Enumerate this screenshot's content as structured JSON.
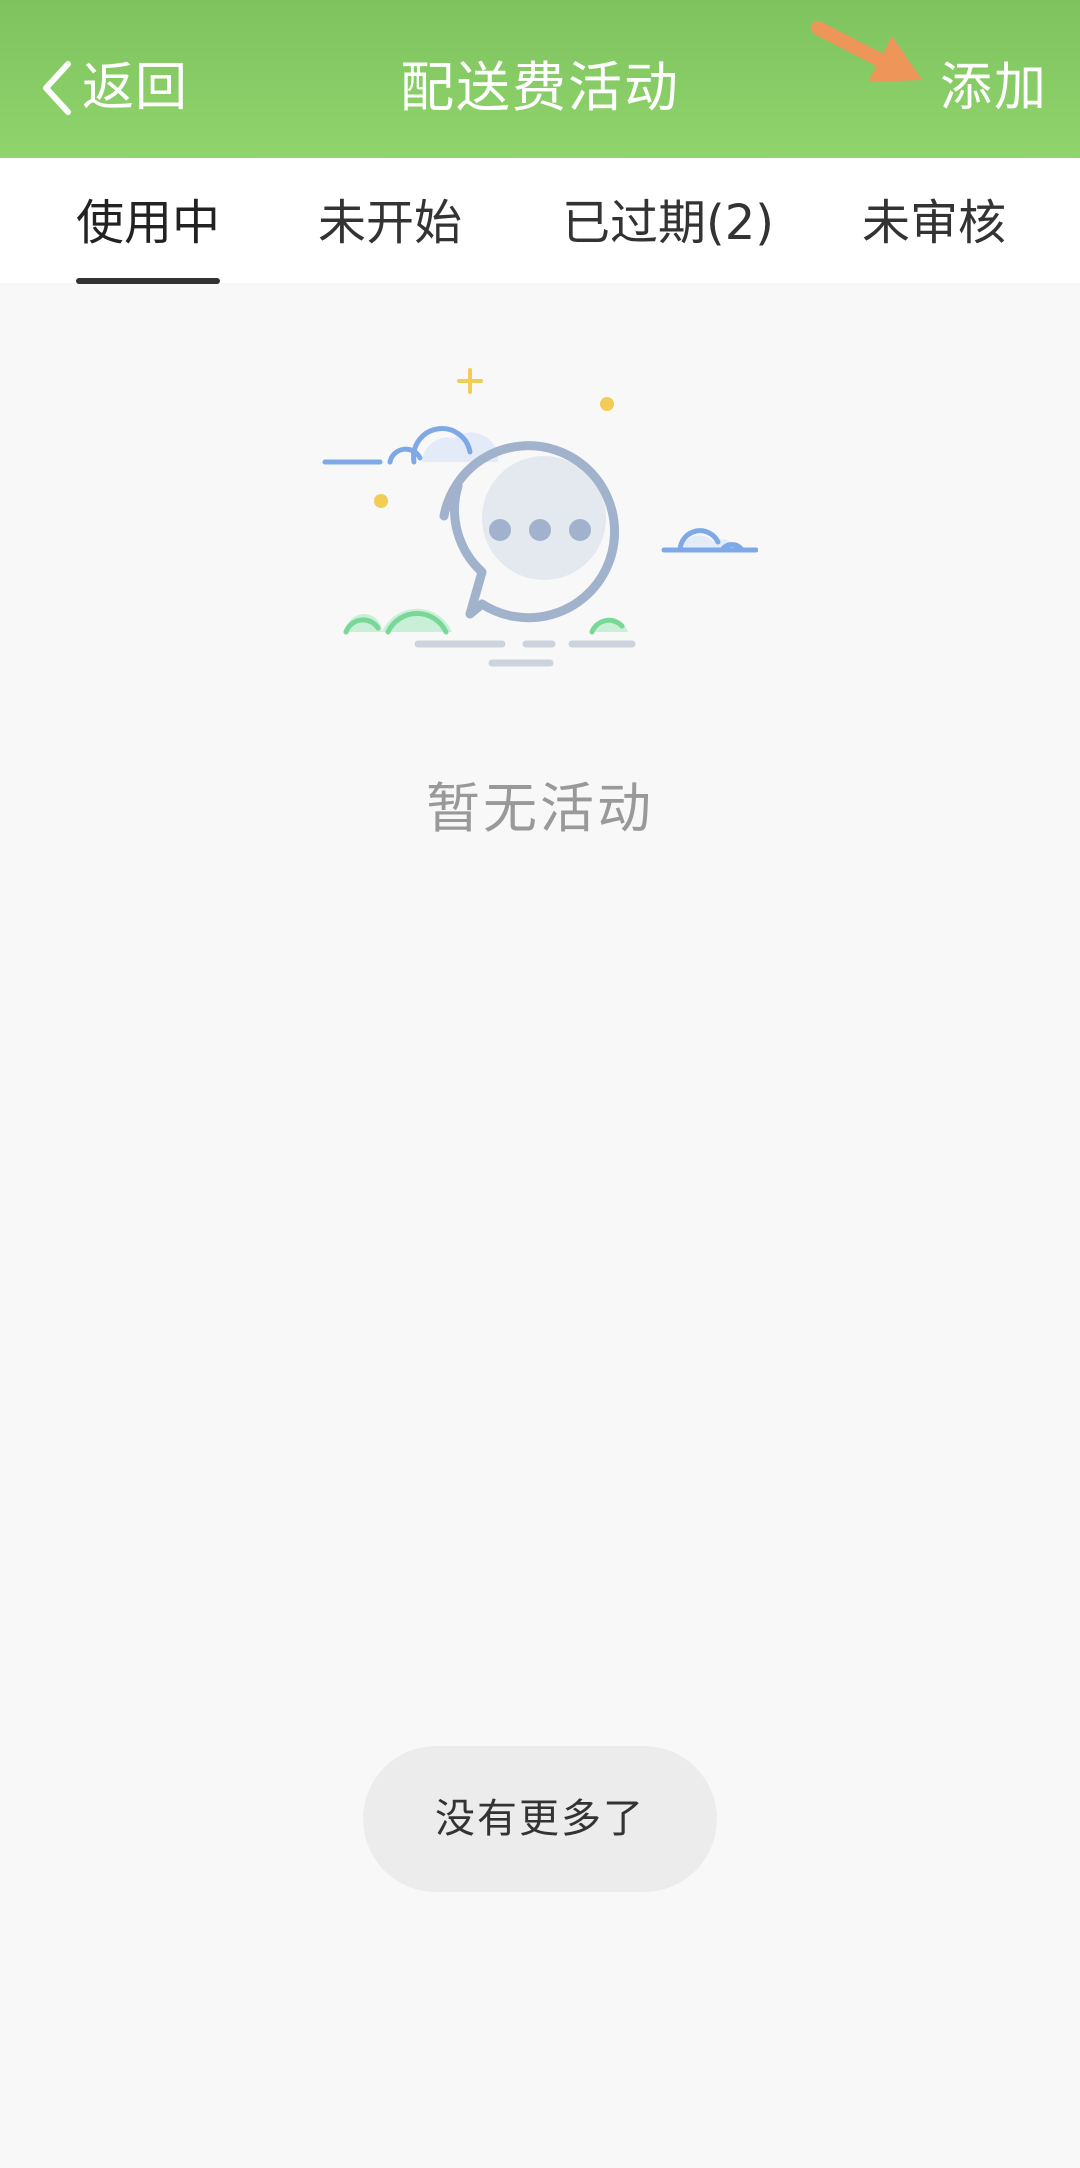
{
  "header": {
    "back_label": "返回",
    "title": "配送费活动",
    "add_label": "添加",
    "background_color": "#8bcf68"
  },
  "tabs": [
    {
      "label": "使用中",
      "active": true
    },
    {
      "label": "未开始",
      "active": false
    },
    {
      "label": "已过期(2)",
      "active": false
    },
    {
      "label": "未审核",
      "active": false
    }
  ],
  "empty_state": {
    "icon": "chat-bubble-icon",
    "message": "暂无活动"
  },
  "footer": {
    "no_more_label": "没有更多了"
  },
  "annotation": {
    "icon": "arrow-icon",
    "color": "#ee955a"
  }
}
